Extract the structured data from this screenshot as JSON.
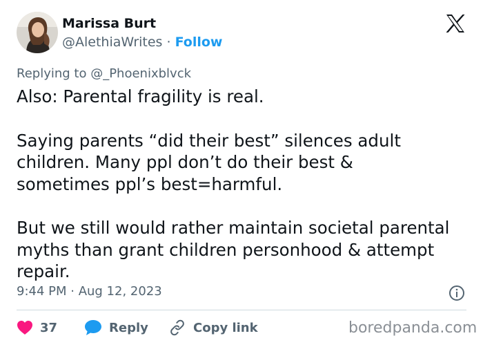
{
  "author": {
    "name": "Marissa Burt",
    "handle": "@AlethiaWrites",
    "separator": "·",
    "follow_label": "Follow",
    "avatar_icon": "profile-photo"
  },
  "platform_icon": "x-logo-icon",
  "reply": {
    "prefix": "Replying to ",
    "target": "@_Phoenixblvck"
  },
  "tweet": {
    "paragraphs": [
      [
        "Also: Parental fragility is real."
      ],
      [
        "Saying parents “did their best” silences adult",
        "children. Many ppl don’t do their best &",
        "sometimes ppl’s best=harmful."
      ],
      [
        "But we still would rather maintain societal parental",
        "myths than grant children personhood & attempt",
        "repair."
      ]
    ]
  },
  "meta": {
    "timestamp": "9:44 PM · Aug 12, 2023"
  },
  "actions": {
    "like_count": "37",
    "reply_label": "Reply",
    "copy_label": "Copy link"
  },
  "watermark": "boredpanda.com",
  "colors": {
    "accent": "#1d9bf0",
    "like": "#f91880",
    "text": "#0f1419",
    "muted": "#536471"
  }
}
